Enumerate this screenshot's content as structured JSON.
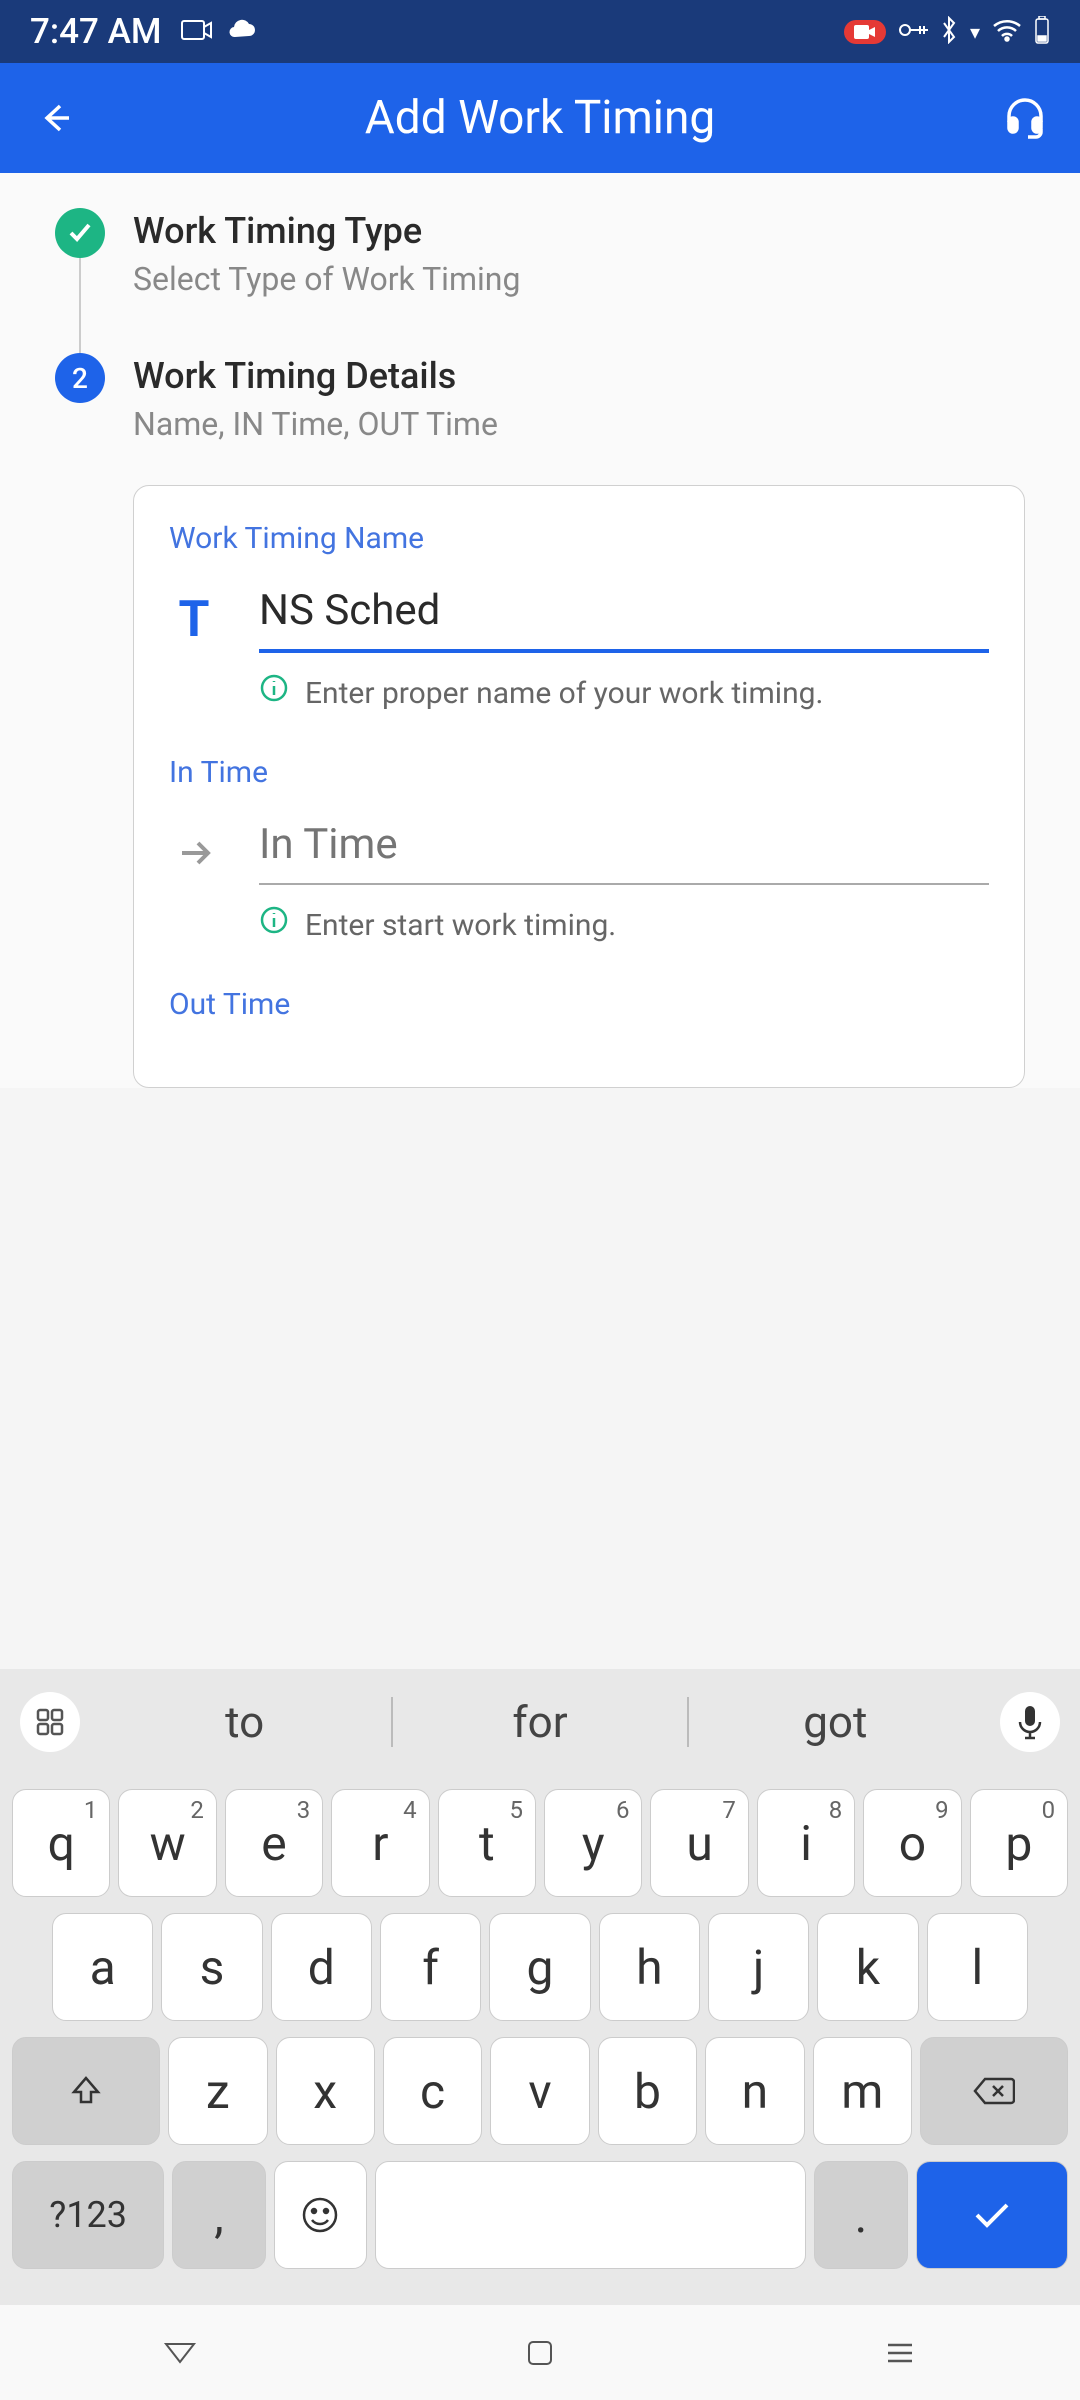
{
  "status": {
    "time": "7:47 AM"
  },
  "appbar": {
    "title": "Add Work Timing"
  },
  "steps": {
    "step1": {
      "title": "Work Timing Type",
      "subtitle": "Select Type of Work Timing"
    },
    "step2": {
      "number": "2",
      "title": "Work Timing Details",
      "subtitle": "Name, IN Time, OUT Time"
    }
  },
  "form": {
    "name": {
      "label": "Work Timing Name",
      "icon": "T",
      "value": "NS Sched",
      "hint": "Enter proper name of your work timing."
    },
    "intime": {
      "label": "In Time",
      "placeholder": "In Time",
      "hint": "Enter start work timing."
    },
    "outtime": {
      "label": "Out Time"
    }
  },
  "keyboard": {
    "suggestions": [
      "to",
      "for",
      "got"
    ],
    "row1": [
      {
        "k": "q",
        "s": "1"
      },
      {
        "k": "w",
        "s": "2"
      },
      {
        "k": "e",
        "s": "3"
      },
      {
        "k": "r",
        "s": "4"
      },
      {
        "k": "t",
        "s": "5"
      },
      {
        "k": "y",
        "s": "6"
      },
      {
        "k": "u",
        "s": "7"
      },
      {
        "k": "i",
        "s": "8"
      },
      {
        "k": "o",
        "s": "9"
      },
      {
        "k": "p",
        "s": "0"
      }
    ],
    "row2": [
      "a",
      "s",
      "d",
      "f",
      "g",
      "h",
      "j",
      "k",
      "l"
    ],
    "row3": [
      "z",
      "x",
      "c",
      "v",
      "b",
      "n",
      "m"
    ],
    "sym": "?123",
    "comma": ",",
    "period": "."
  }
}
